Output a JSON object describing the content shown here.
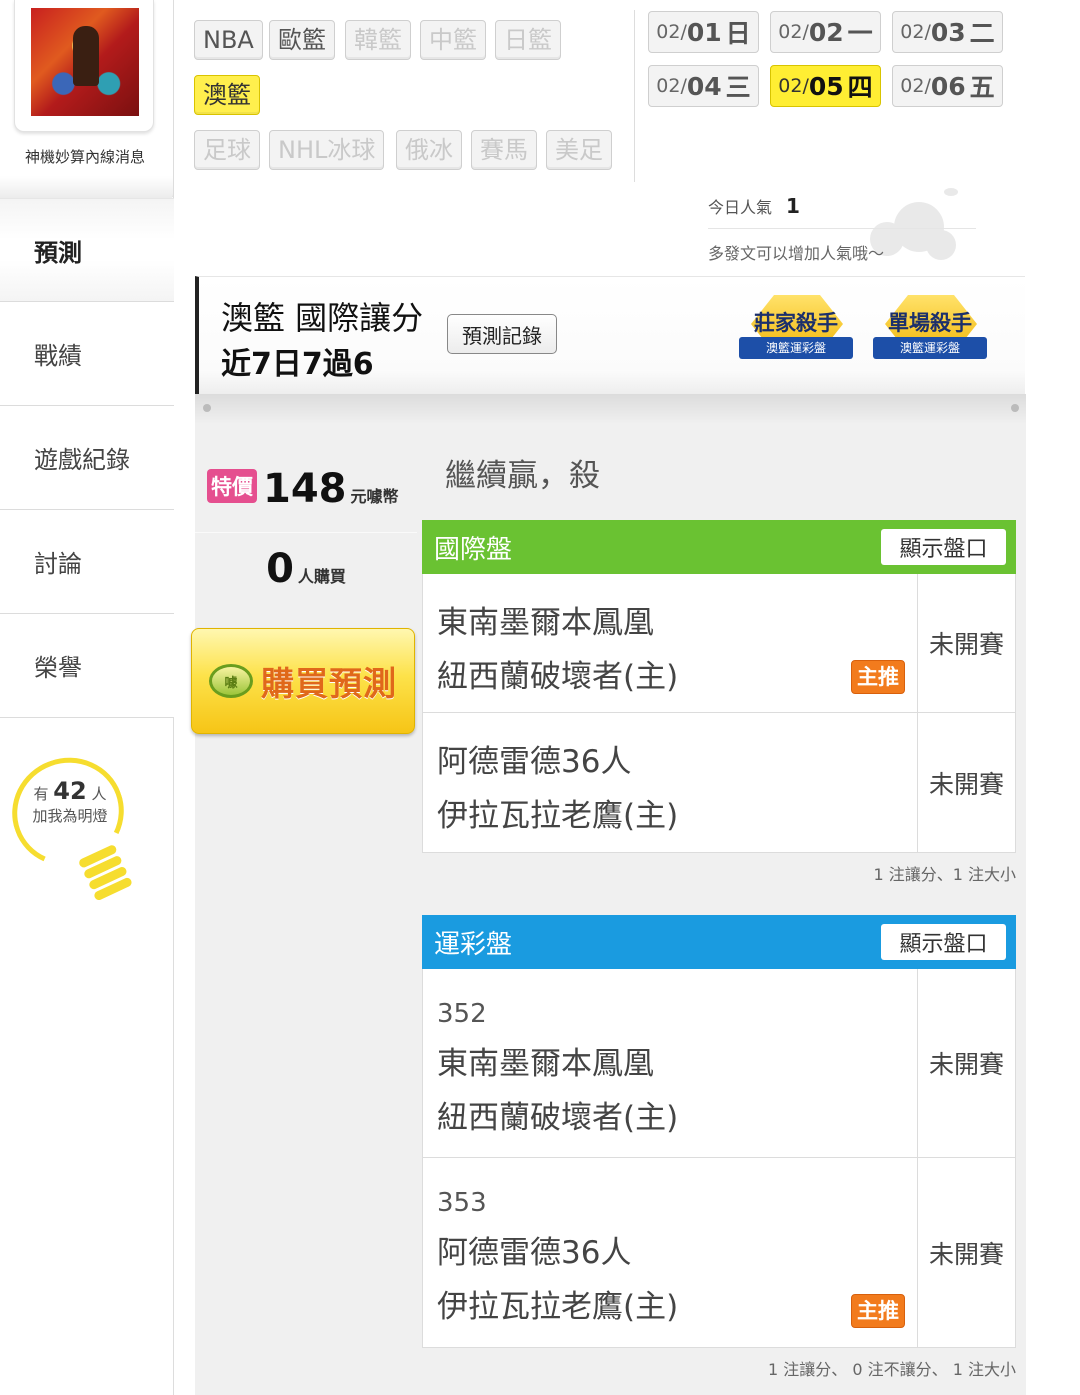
{
  "user": {
    "name": "神機妙算內線消息"
  },
  "sidebar": {
    "items": [
      {
        "label": "預測",
        "active": true
      },
      {
        "label": "戰績",
        "active": false
      },
      {
        "label": "遊戲紀錄",
        "active": false
      },
      {
        "label": "討論",
        "active": false
      },
      {
        "label": "榮譽",
        "active": false
      }
    ],
    "light": {
      "prefix": "有",
      "count": "42",
      "suffix": "人",
      "caption": "加我為明燈"
    }
  },
  "leagues": [
    {
      "label": "NBA",
      "state": "normal"
    },
    {
      "label": "歐籃",
      "state": "normal"
    },
    {
      "label": "韓籃",
      "state": "disabled"
    },
    {
      "label": "中籃",
      "state": "disabled"
    },
    {
      "label": "日籃",
      "state": "disabled"
    },
    {
      "label": "澳籃",
      "state": "active"
    },
    {
      "label": "足球",
      "state": "disabled"
    },
    {
      "label": "NHL冰球",
      "state": "disabled"
    },
    {
      "label": "俄冰",
      "state": "disabled"
    },
    {
      "label": "賽馬",
      "state": "disabled"
    },
    {
      "label": "美足",
      "state": "disabled"
    }
  ],
  "dates": [
    {
      "month": "02/",
      "day": "01",
      "weekday": "日",
      "active": false
    },
    {
      "month": "02/",
      "day": "02",
      "weekday": "一",
      "active": false
    },
    {
      "month": "02/",
      "day": "03",
      "weekday": "二",
      "active": false
    },
    {
      "month": "02/",
      "day": "04",
      "weekday": "三",
      "active": false
    },
    {
      "month": "02/",
      "day": "05",
      "weekday": "四",
      "active": true
    },
    {
      "month": "02/",
      "day": "06",
      "weekday": "五",
      "active": false
    }
  ],
  "popularity": {
    "label": "今日人氣",
    "value": "1",
    "hint": "多發文可以增加人氣哦～"
  },
  "banner": {
    "title": "澳籃 國際讓分",
    "record": "近7日7過6",
    "record_button": "預測記錄",
    "badges": [
      {
        "title": "莊家殺手",
        "ribbon": "澳籃運彩盤"
      },
      {
        "title": "單場殺手",
        "ribbon": "澳籃運彩盤"
      }
    ]
  },
  "purchase": {
    "special_label": "特價",
    "price": "148",
    "currency": "元噱幣",
    "buyers": "0",
    "buyers_label": "人購買",
    "buy_button": "購買預測",
    "coin_label": "噱"
  },
  "slogan": "繼續贏，殺",
  "sections": [
    {
      "title": "國際盤",
      "color": "#6ac232",
      "show_button": "顯示盤口",
      "matches": [
        {
          "code": "",
          "away": "東南墨爾本鳳凰",
          "home": "紐西蘭破壞者(主)",
          "status": "未開賽",
          "pick": "主推"
        },
        {
          "code": "",
          "away": "阿德雷德36人",
          "home": "伊拉瓦拉老鷹(主)",
          "status": "未開賽",
          "pick": ""
        }
      ],
      "summary": "1 注讓分、1 注大小"
    },
    {
      "title": "運彩盤",
      "color": "#1a9be0",
      "show_button": "顯示盤口",
      "matches": [
        {
          "code": "352",
          "away": "東南墨爾本鳳凰",
          "home": "紐西蘭破壞者(主)",
          "status": "未開賽",
          "pick": ""
        },
        {
          "code": "353",
          "away": "阿德雷德36人",
          "home": "伊拉瓦拉老鷹(主)",
          "status": "未開賽",
          "pick": "主推"
        }
      ],
      "summary": "1 注讓分、 0 注不讓分、 1 注大小"
    }
  ]
}
